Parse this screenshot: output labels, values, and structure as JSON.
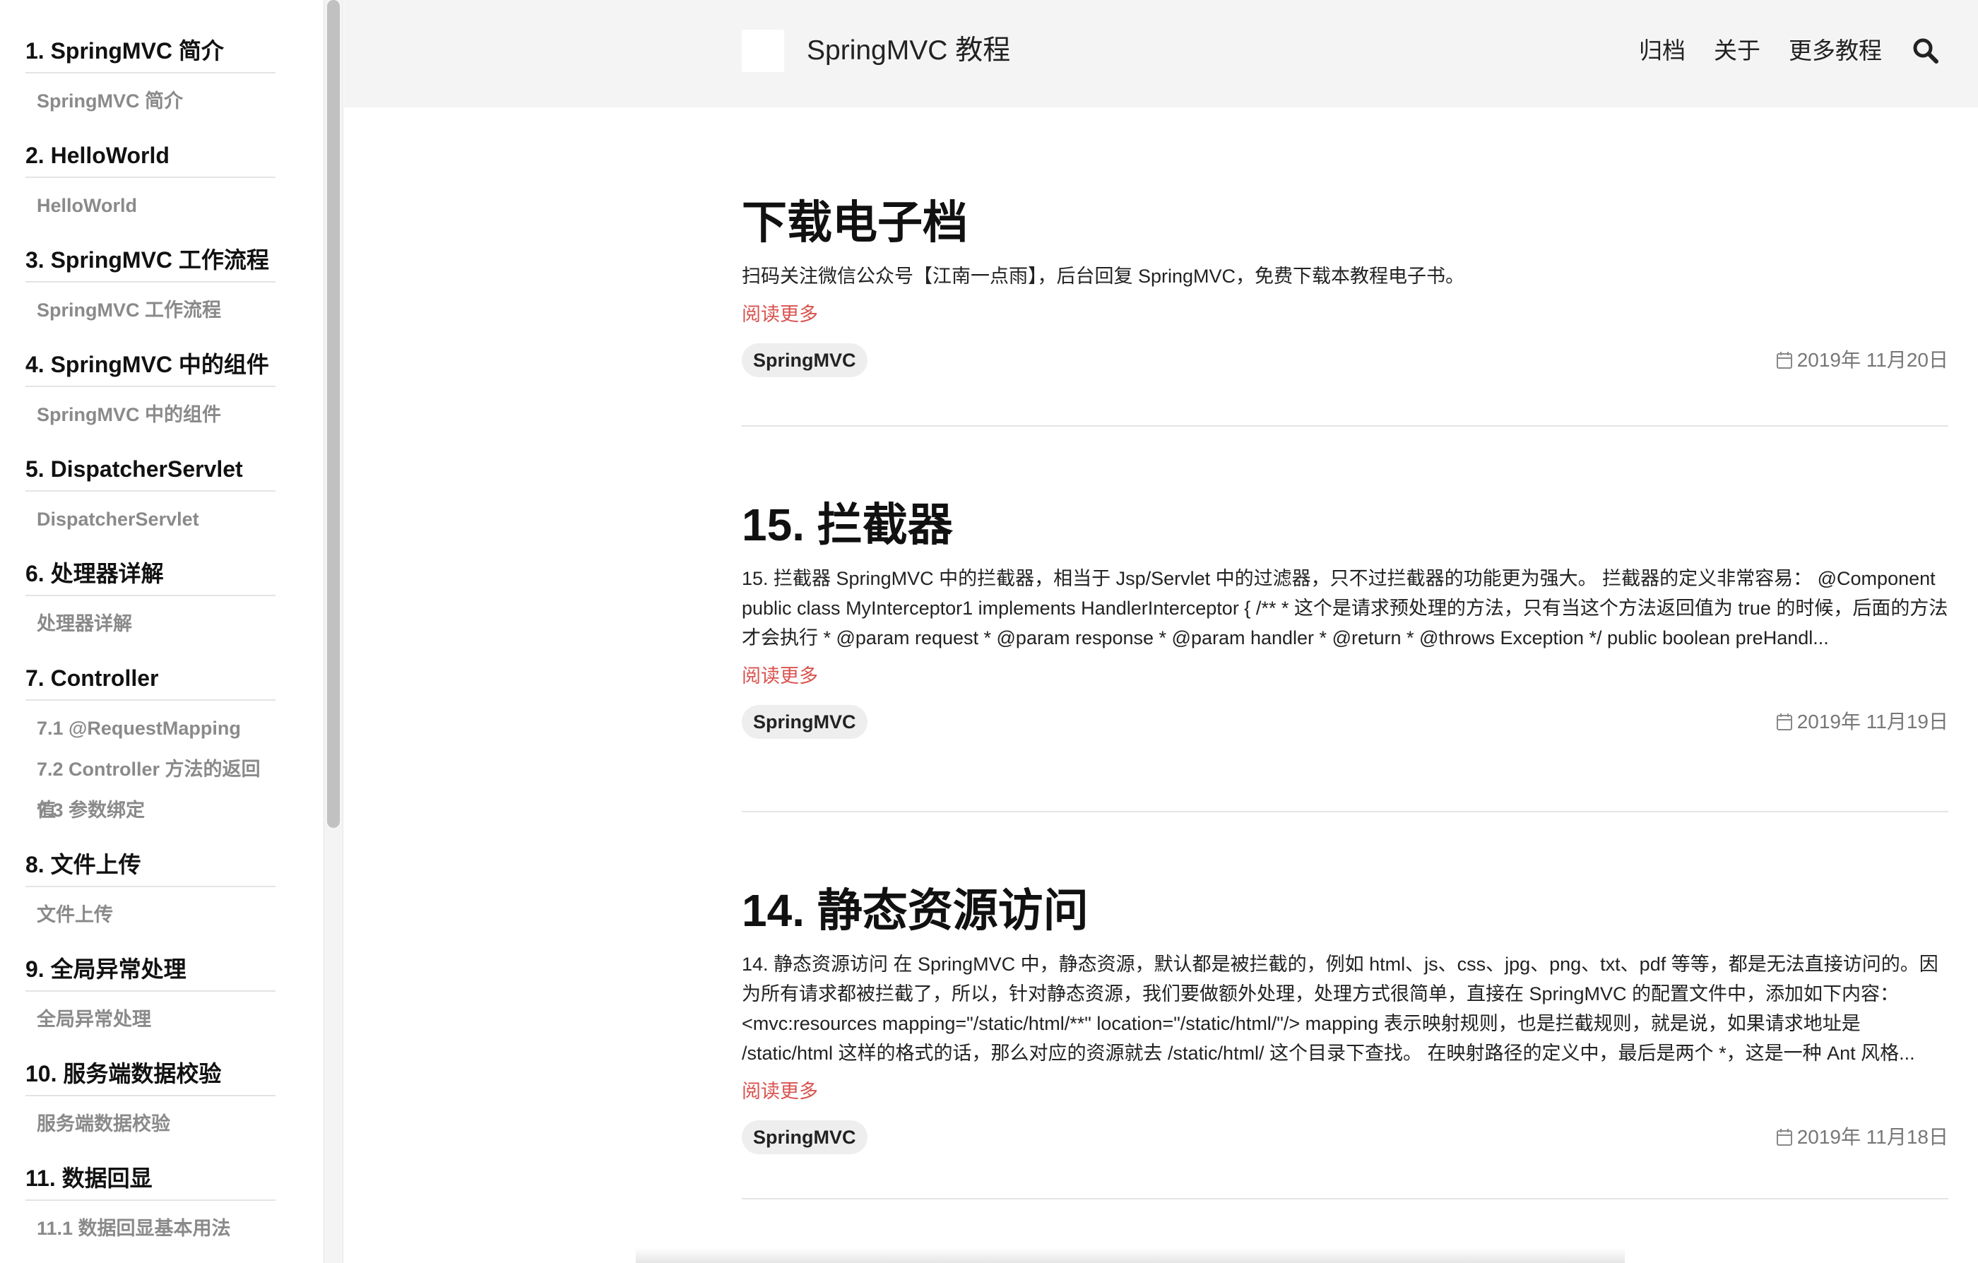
{
  "sidebar": {
    "sections": [
      {
        "title": "1. SpringMVC 简介",
        "items": [
          "SpringMVC 简介"
        ]
      },
      {
        "title": "2. HelloWorld",
        "items": [
          "HelloWorld"
        ]
      },
      {
        "title": "3. SpringMVC 工作流程",
        "items": [
          "SpringMVC 工作流程"
        ]
      },
      {
        "title": "4. SpringMVC 中的组件",
        "items": [
          "SpringMVC 中的组件"
        ]
      },
      {
        "title": "5. DispatcherServlet",
        "items": [
          "DispatcherServlet"
        ]
      },
      {
        "title": "6. 处理器详解",
        "items": [
          "处理器详解"
        ]
      },
      {
        "title": "7. Controller",
        "items": [
          "7.1 @RequestMapping",
          "7.2 Controller 方法的返回值",
          "7.3 参数绑定"
        ]
      },
      {
        "title": "8. 文件上传",
        "items": [
          "文件上传"
        ]
      },
      {
        "title": "9. 全局异常处理",
        "items": [
          "全局异常处理"
        ]
      },
      {
        "title": "10. 服务端数据校验",
        "items": [
          "服务端数据校验"
        ]
      },
      {
        "title": "11. 数据回显",
        "items": [
          "11.1 数据回显基本用法"
        ]
      }
    ]
  },
  "header": {
    "site_title": "SpringMVC 教程",
    "nav": [
      "归档",
      "关于",
      "更多教程"
    ],
    "search_icon": "search-icon"
  },
  "posts": [
    {
      "title": "下载电子档",
      "summary": "扫码关注微信公众号【江南一点雨】，后台回复 SpringMVC，免费下载本教程电子书。",
      "read_more": "阅读更多",
      "tag": "SpringMVC",
      "date": "2019年 11月20日"
    },
    {
      "title": "15. 拦截器",
      "summary": "15. 拦截器 SpringMVC 中的拦截器，相当于 Jsp/Servlet 中的过滤器，只不过拦截器的功能更为强大。 拦截器的定义非常容易： @Component public class MyInterceptor1 implements HandlerInterceptor { /** * 这个是请求预处理的方法，只有当这个方法返回值为 true 的时候，后面的方法才会执行 * @param request * @param response * @param handler * @return * @throws Exception */ public boolean preHandl...",
      "read_more": "阅读更多",
      "tag": "SpringMVC",
      "date": "2019年 11月19日"
    },
    {
      "title": "14. 静态资源访问",
      "summary": "14. 静态资源访问 在 SpringMVC 中，静态资源，默认都是被拦截的，例如 html、js、css、jpg、png、txt、pdf 等等，都是无法直接访问的。因为所有请求都被拦截了，所以，针对静态资源，我们要做额外处理，处理方式很简单，直接在 SpringMVC 的配置文件中，添加如下内容： <mvc:resources mapping=\"/static/html/**\" location=\"/static/html/\"/> mapping 表示映射规则，也是拦截规则，就是说，如果请求地址是 /static/html 这样的格式的话，那么对应的资源就去 /static/html/ 这个目录下查找。 在映射路径的定义中，最后是两个 *，这是一种 Ant 风格...",
      "read_more": "阅读更多",
      "tag": "SpringMVC",
      "date": "2019年 11月18日"
    }
  ],
  "colors": {
    "accent_link": "#d9534f",
    "header_bg": "#f4f4f4",
    "tag_bg": "#eeeeee"
  }
}
